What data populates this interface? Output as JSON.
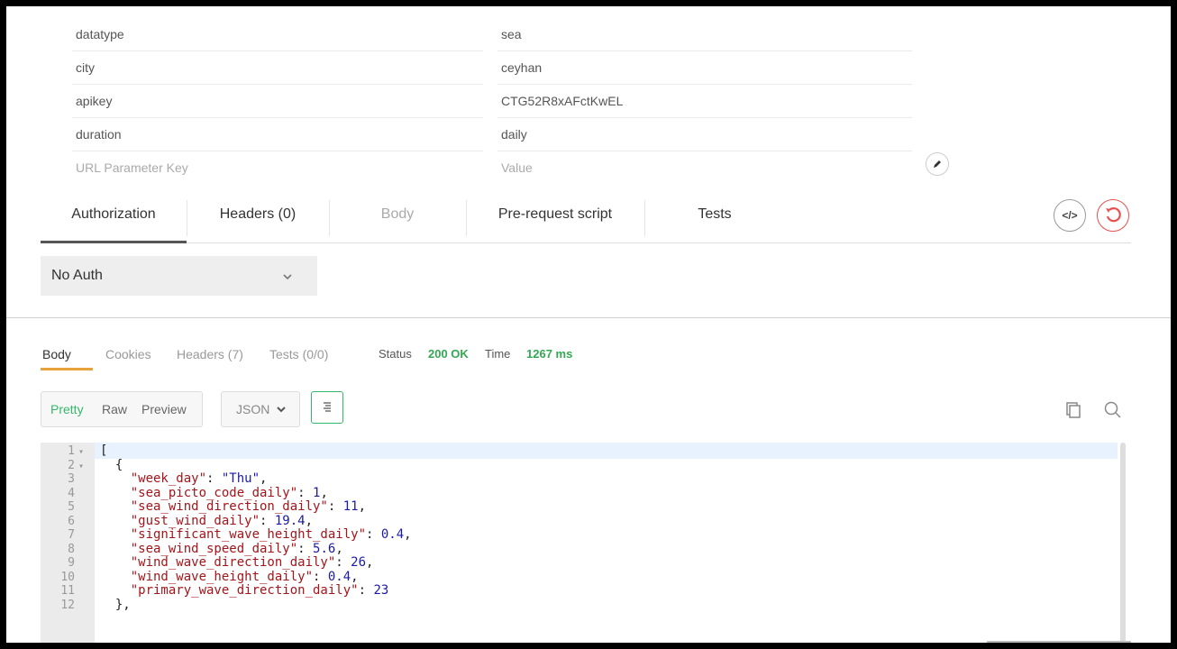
{
  "params": [
    {
      "key": "datatype",
      "value": "sea"
    },
    {
      "key": "city",
      "value": "ceyhan"
    },
    {
      "key": "apikey",
      "value": "CTG52R8xAFctKwEL"
    },
    {
      "key": "duration",
      "value": "daily"
    }
  ],
  "param_placeholder": {
    "key": "URL Parameter Key",
    "value": "Value"
  },
  "request_tabs": {
    "authorization": "Authorization",
    "headers": "Headers (0)",
    "body": "Body",
    "prerequest": "Pre-request script",
    "tests": "Tests"
  },
  "code_button_label": "</>",
  "auth": {
    "selected": "No Auth"
  },
  "response_tabs": {
    "body": "Body",
    "cookies": "Cookies",
    "headers": "Headers (7)",
    "tests": "Tests (0/0)"
  },
  "status": {
    "label": "Status",
    "value": "200 OK",
    "time_label": "Time",
    "time_value": "1267 ms"
  },
  "format": {
    "pretty": "Pretty",
    "raw": "Raw",
    "preview": "Preview",
    "language": "JSON"
  },
  "colors": {
    "accent_green": "#32a852",
    "tab_underline": "#e8a23c",
    "reset_red": "#e84f4f"
  },
  "code": {
    "line_numbers": [
      "1",
      "2",
      "3",
      "4",
      "5",
      "6",
      "7",
      "8",
      "9",
      "10",
      "11",
      "12"
    ],
    "lines": [
      "[",
      "  {",
      "    \"week_day\": \"Thu\",",
      "    \"sea_picto_code_daily\": 1,",
      "    \"sea_wind_direction_daily\": 11,",
      "    \"gust_wind_daily\": 19.4,",
      "    \"significant_wave_height_daily\": 0.4,",
      "    \"sea_wind_speed_daily\": 5.6,",
      "    \"wind_wave_direction_daily\": 26,",
      "    \"wind_wave_height_daily\": 0.4,",
      "    \"primary_wave_direction_daily\": 23",
      "  },"
    ]
  }
}
